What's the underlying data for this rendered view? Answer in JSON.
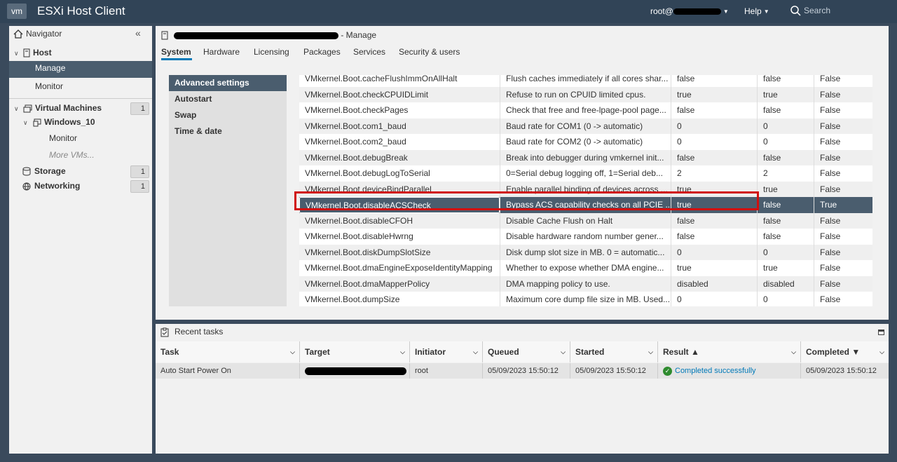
{
  "topbar": {
    "logo": "vm",
    "title": "ESXi Host Client",
    "user": "root@",
    "help": "Help",
    "search_placeholder": "Search"
  },
  "navigator": {
    "title": "Navigator",
    "host": "Host",
    "manage": "Manage",
    "monitor": "Monitor",
    "virtual_machines": "Virtual Machines",
    "vm_count": "1",
    "vm_name": "Windows_10",
    "vm_monitor": "Monitor",
    "more_vms": "More VMs...",
    "storage": "Storage",
    "storage_count": "1",
    "networking": "Networking",
    "networking_count": "1"
  },
  "main": {
    "title_suffix": "- Manage",
    "tabs": [
      "System",
      "Hardware",
      "Licensing",
      "Packages",
      "Services",
      "Security & users"
    ],
    "subnav": [
      "Advanced settings",
      "Autostart",
      "Swap",
      "Time & date"
    ]
  },
  "settings_rows": [
    [
      "VMkernel.Boot.cacheFlushImmOnAllHalt",
      "Flush caches immediately if all cores shar...",
      "false",
      "false",
      "False"
    ],
    [
      "VMkernel.Boot.checkCPUIDLimit",
      "Refuse to run on CPUID limited cpus.",
      "true",
      "true",
      "False"
    ],
    [
      "VMkernel.Boot.checkPages",
      "Check that free and free-lpage-pool page...",
      "false",
      "false",
      "False"
    ],
    [
      "VMkernel.Boot.com1_baud",
      "Baud rate for COM1 (0 -> automatic)",
      "0",
      "0",
      "False"
    ],
    [
      "VMkernel.Boot.com2_baud",
      "Baud rate for COM2 (0 -> automatic)",
      "0",
      "0",
      "False"
    ],
    [
      "VMkernel.Boot.debugBreak",
      "Break into debugger during vmkernel init...",
      "false",
      "false",
      "False"
    ],
    [
      "VMkernel.Boot.debugLogToSerial",
      "0=Serial debug logging off, 1=Serial deb...",
      "2",
      "2",
      "False"
    ],
    [
      "VMkernel.Boot.deviceBindParallel",
      "Enable parallel binding of devices across ...",
      "true",
      "true",
      "False"
    ],
    [
      "VMkernel.Boot.disableACSCheck",
      "Bypass ACS capability checks on all PCIE ...",
      "true",
      "false",
      "True"
    ],
    [
      "VMkernel.Boot.disableCFOH",
      "Disable Cache Flush on Halt",
      "false",
      "false",
      "False"
    ],
    [
      "VMkernel.Boot.disableHwrng",
      "Disable hardware random number gener...",
      "false",
      "false",
      "False"
    ],
    [
      "VMkernel.Boot.diskDumpSlotSize",
      "Disk dump slot size in MB. 0 = automatic...",
      "0",
      "0",
      "False"
    ],
    [
      "VMkernel.Boot.dmaEngineExposeIdentityMapping",
      "Whether to expose whether DMA engine...",
      "true",
      "true",
      "False"
    ],
    [
      "VMkernel.Boot.dmaMapperPolicy",
      "DMA mapping policy to use.",
      "disabled",
      "disabled",
      "False"
    ],
    [
      "VMkernel.Boot.dumpSize",
      "Maximum core dump file size in MB. Used...",
      "0",
      "0",
      "False"
    ]
  ],
  "tasks": {
    "title": "Recent tasks",
    "headers": [
      "Task",
      "Target",
      "Initiator",
      "Queued",
      "Started",
      "Result ▲",
      "Completed ▼"
    ],
    "row": {
      "task": "Auto Start Power On",
      "initiator": "root",
      "queued": "05/09/2023 15:50:12",
      "started": "05/09/2023 15:50:12",
      "result": "Completed successfully",
      "completed": "05/09/2023 15:50:12"
    },
    "result_color": "#0079b8"
  }
}
